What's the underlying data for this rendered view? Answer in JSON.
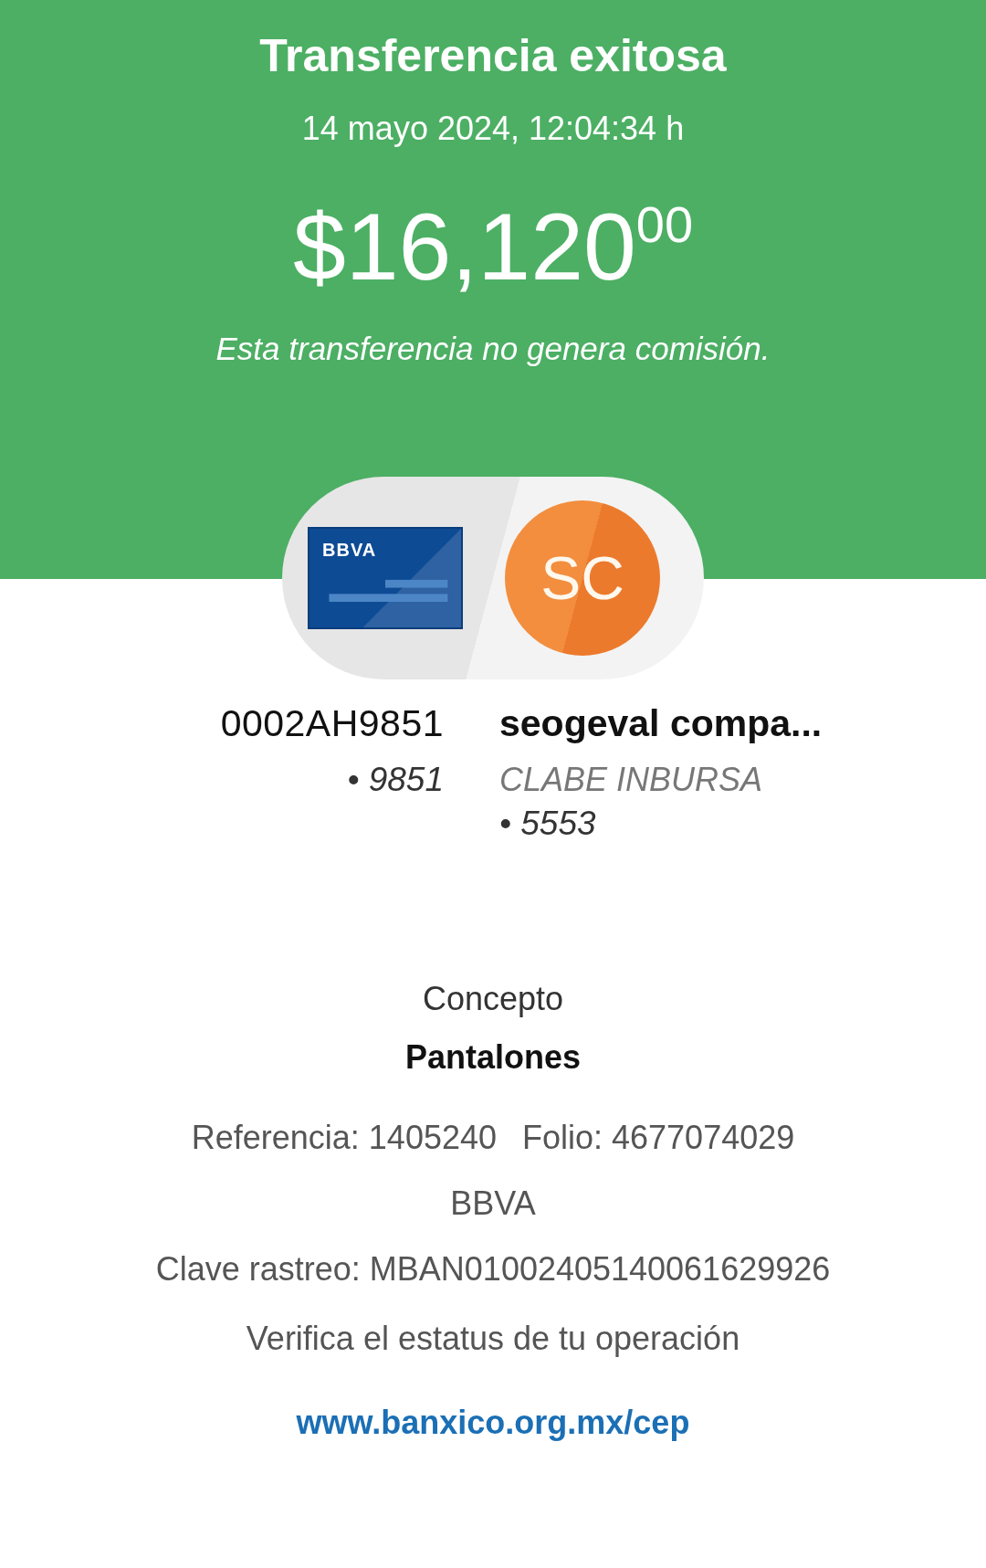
{
  "header": {
    "title": "Transferencia exitosa",
    "datetime": "14 mayo 2024, 12:04:34 h",
    "amount": {
      "whole": "$16,120",
      "cents": "00"
    },
    "note": "Esta transferencia no genera comisión."
  },
  "transfer_badge": {
    "card_brand": "BBVA",
    "recipient_initials": "SC"
  },
  "origin": {
    "name": "0002AH9851",
    "account": "• 9851"
  },
  "destination": {
    "name": "seogeval compa...",
    "bank": "CLABE INBURSA",
    "account": "• 5553"
  },
  "concept": {
    "label": "Concepto",
    "value": "Pantalones"
  },
  "details": {
    "reference": "Referencia: 1405240",
    "folio": "Folio: 4677074029",
    "bank": "BBVA",
    "tracking": "Clave rastreo: MBAN01002405140061629926"
  },
  "verify": {
    "text": "Verifica el estatus de tu operación",
    "link": "www.banxico.org.mx/cep"
  }
}
